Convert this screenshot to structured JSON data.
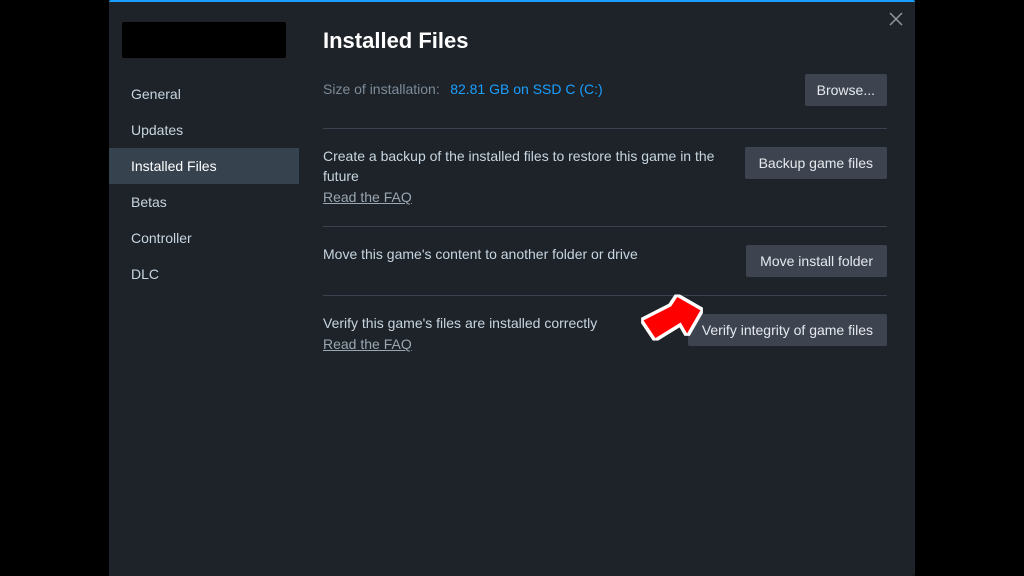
{
  "sidebar": {
    "items": [
      {
        "label": "General"
      },
      {
        "label": "Updates"
      },
      {
        "label": "Installed Files"
      },
      {
        "label": "Betas"
      },
      {
        "label": "Controller"
      },
      {
        "label": "DLC"
      }
    ],
    "active_index": 2
  },
  "page": {
    "title": "Installed Files",
    "size_label": "Size of installation:",
    "size_value": "82.81 GB on SSD C (C:)",
    "browse_btn": "Browse...",
    "rows": [
      {
        "text": "Create a backup of the installed files to restore this game in the future",
        "faq": "Read the FAQ",
        "button": "Backup game files"
      },
      {
        "text": "Move this game's content to another folder or drive",
        "faq": null,
        "button": "Move install folder"
      },
      {
        "text": "Verify this game's files are installed correctly",
        "faq": "Read the FAQ",
        "button": "Verify integrity of game files"
      }
    ]
  }
}
